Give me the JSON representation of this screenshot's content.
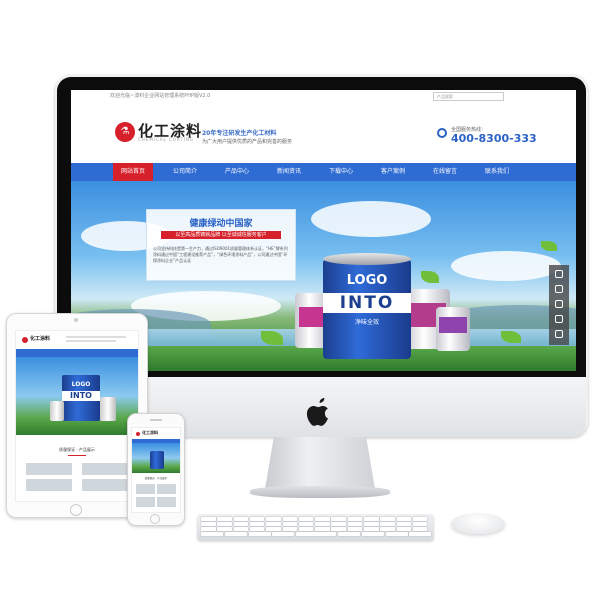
{
  "site": {
    "topbar_text": "欢迎光临~漆料企业网站管理系统PHP版V2.0",
    "search_placeholder": "产品搜索",
    "logo_text": "化工涂料",
    "logo_sub": "CHEMICAL COATING",
    "slogan_main": "20年专注研发生产化工材料",
    "slogan_sub": "为广大用户提供优质的产品和完善的服务",
    "hotline_label": "全国服务热线：",
    "hotline_number": "400-8300-333"
  },
  "nav": {
    "items": [
      "网站首页",
      "公司简介",
      "产品中心",
      "新闻资讯",
      "下载中心",
      "客户案例",
      "在线留言",
      "联系我们"
    ],
    "active_index": 0
  },
  "banner": {
    "panel_title": "健康绿动中国家",
    "panel_bar": "以至高品质铸就品牌 以至诚诚信服务客户",
    "panel_text": "公司坚持科技是第一生产力，通过ISO9001质量管理体系认证，“HE”牌系列涂料通过中国“工程建设推荐产品”，“绿色环境涂料产品”，公司通过中国“环保涂料企业”产品认证",
    "can_logo": "LOGO",
    "can_band": "INTO",
    "can_sub": "净味全效"
  },
  "tablet": {
    "logo_text": "化工涂料",
    "can_logo": "LOGO",
    "can_band": "INTO",
    "section_title": "质量保证 · 产品展示"
  },
  "phone": {
    "logo_text": "化工涂料",
    "section_title": "质量保证 · 产品展示"
  },
  "colors": {
    "brand_blue": "#2e6bd3",
    "brand_red": "#d6202a",
    "hotline_blue": "#2a62c6"
  },
  "icons": {
    "side_toolbar": [
      "headset-icon",
      "chat-icon",
      "qq-icon",
      "wechat-icon",
      "back-to-top-icon"
    ],
    "apple": "apple-logo-icon",
    "hotline": "phone-icon"
  }
}
